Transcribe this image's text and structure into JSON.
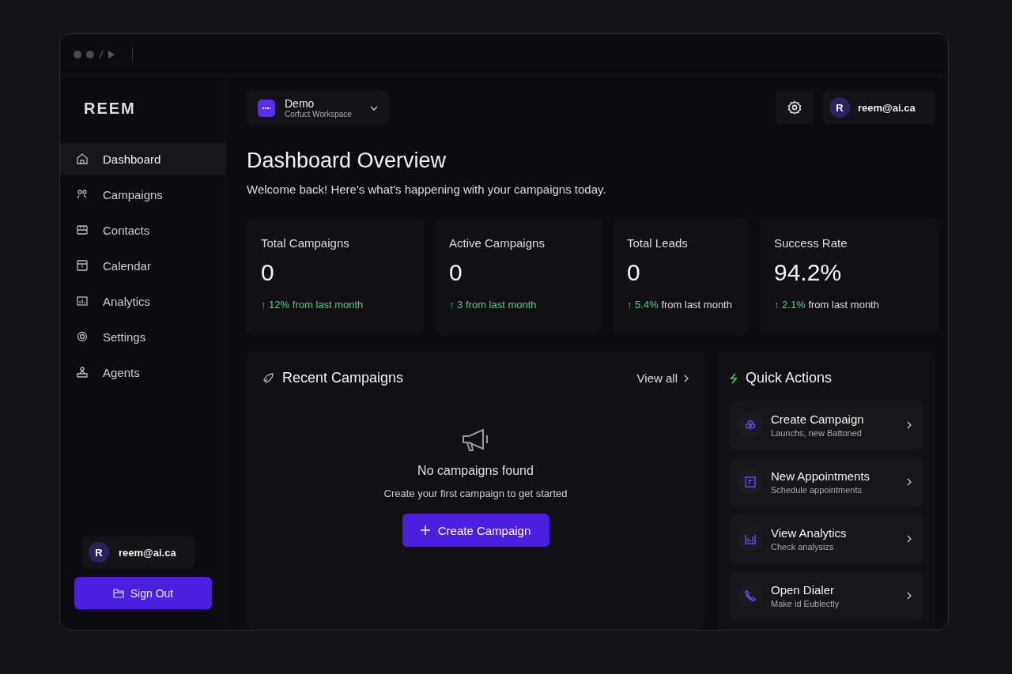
{
  "brand": "REEM",
  "nav": [
    {
      "label": "Dashboard",
      "selected": true
    },
    {
      "label": "Campaigns",
      "selected": false
    },
    {
      "label": "Contacts",
      "selected": false
    },
    {
      "label": "Calendar",
      "selected": false
    },
    {
      "label": "Analytics",
      "selected": false
    },
    {
      "label": "Settings",
      "selected": false
    },
    {
      "label": "Agents",
      "selected": false
    }
  ],
  "sidebar_user": {
    "initial": "R",
    "email": "reem@ai.ca"
  },
  "sign_out": "Sign Out",
  "workspace": {
    "name": "Demo",
    "subtitle": "Corfuct Workspace"
  },
  "header_user": {
    "initial": "R",
    "email": "reem@ai.ca"
  },
  "title": "Dashboard Overview",
  "subtitle": "Welcome back! Here's what's happening with your campaigns today.",
  "stats": [
    {
      "label": "Total Campaigns",
      "value": "0",
      "delta": "↑ 12%",
      "note": "from last month",
      "note_accent": true
    },
    {
      "label": "Active Campaigns",
      "value": "0",
      "delta": "↑ 3",
      "note": "from last month",
      "note_accent": true
    },
    {
      "label": "Total Leads",
      "value": "0",
      "delta": "↑ 5.4%",
      "note": "from last month",
      "note_accent": false
    },
    {
      "label": "Success Rate",
      "value": "94.2%",
      "delta": "↑ 2.1%",
      "note": "from last month",
      "note_accent": false
    }
  ],
  "recent": {
    "title": "Recent Campaigns",
    "view_all": "View all",
    "empty_title": "No campaigns found",
    "empty_text": "Create your first campaign to get started",
    "button": "Create Campaign"
  },
  "quick": {
    "title": "Quick Actions",
    "actions": [
      {
        "title": "Create Campaign",
        "subtitle": "Launchs, new Battoned"
      },
      {
        "title": "New Appointments",
        "subtitle": "Schedule appointments"
      },
      {
        "title": "View Analytics",
        "subtitle": "Check analysizs"
      },
      {
        "title": "Open Dialer",
        "subtitle": "Make id Eublectly"
      }
    ]
  }
}
